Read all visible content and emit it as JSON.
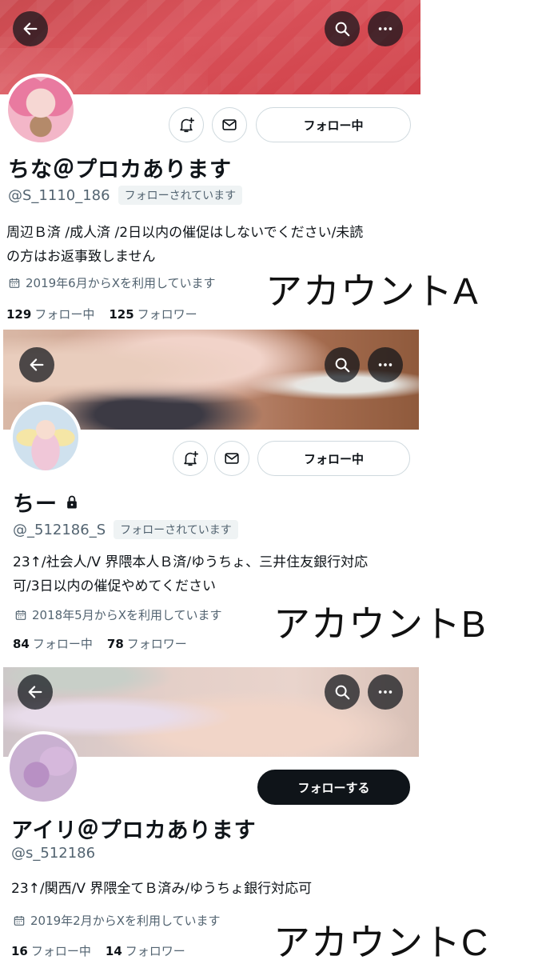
{
  "profiles": [
    {
      "name": "ちな＠プロカあります",
      "handle": "@S_1110_186",
      "follows_you_badge": "フォローされています",
      "bio_lines": [
        "周辺Ｂ済 /成人済 /2日以内の催促はしないでください/未読",
        "の方はお返事致しません"
      ],
      "joined": "2019年6月からXを利用しています",
      "following_count": "129",
      "following_label": "フォロー中",
      "followers_count": "125",
      "followers_label": "フォロワー",
      "follow_button": "フォロー中",
      "account_label": "アカウントA",
      "banner_color": "#d9525a"
    },
    {
      "name": "ちー",
      "handle": "@_512186_S",
      "follows_you_badge": "フォローされています",
      "bio_lines": [
        "23↑/社会人/V 界隈本人Ｂ済/ゆうちょ、三井住友銀行対応",
        "可/3日以内の催促やめてください"
      ],
      "joined": "2018年5月からXを利用しています",
      "following_count": "84",
      "following_label": "フォロー中",
      "followers_count": "78",
      "followers_label": "フォロワー",
      "follow_button": "フォロー中",
      "account_label": "アカウントB",
      "protected_icon": "lock-icon"
    },
    {
      "name": "アイリ＠プロカあります",
      "handle": "@s_512186",
      "bio_lines": [
        "23↑/関西/V 界隈全てＢ済み/ゆうちょ銀行対応可"
      ],
      "joined": "2019年2月からXを利用しています",
      "following_count": "16",
      "following_label": "フォロー中",
      "followers_count": "14",
      "followers_label": "フォロワー",
      "follow_button": "フォローする",
      "account_label": "アカウントC"
    }
  ],
  "icons": [
    "back-arrow-icon",
    "search-icon",
    "more-icon",
    "bell-plus-icon",
    "mail-icon",
    "calendar-icon",
    "lock-icon"
  ]
}
